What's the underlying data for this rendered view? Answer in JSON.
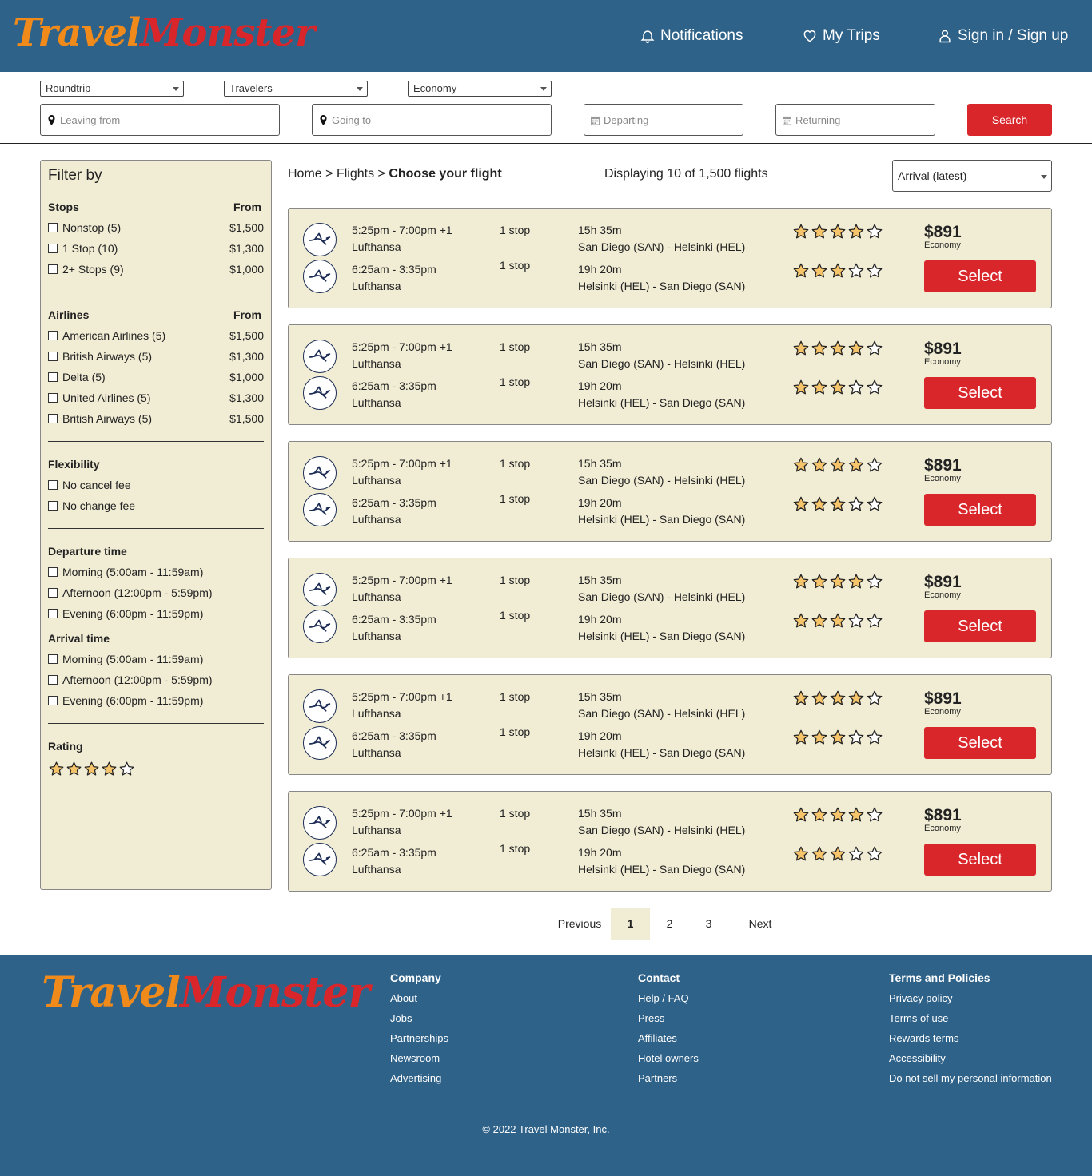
{
  "brand": {
    "name_part1": "Travel",
    "name_part2": "Monster",
    "color_primary": "#f08a1b",
    "color_secondary": "#d9262b"
  },
  "header": {
    "notifications": "Notifications",
    "my_trips": "My Trips",
    "sign_in": "Sign in / Sign up",
    "bg_color": "#2f6289"
  },
  "search": {
    "trip_type": "Roundtrip",
    "travelers": "Travelers",
    "cabin": "Economy",
    "leaving_from_placeholder": "Leaving from",
    "going_to_placeholder": "Going to",
    "departing_placeholder": "Departing",
    "returning_placeholder": "Returning",
    "search_label": "Search"
  },
  "filters": {
    "title": "Filter by",
    "stops": {
      "heading": "Stops",
      "from_label": "From",
      "options": [
        {
          "label": "Nonstop (5)",
          "price": "$1,500"
        },
        {
          "label": "1 Stop (10)",
          "price": "$1,300"
        },
        {
          "label": "2+ Stops (9)",
          "price": "$1,000"
        }
      ]
    },
    "airlines": {
      "heading": "Airlines",
      "from_label": "From",
      "options": [
        {
          "label": "American Airlines (5)",
          "price": "$1,500"
        },
        {
          "label": "British Airways (5)",
          "price": "$1,300"
        },
        {
          "label": "Delta (5)",
          "price": "$1,000"
        },
        {
          "label": "United Airlines (5)",
          "price": "$1,300"
        },
        {
          "label": "British Airways (5)",
          "price": "$1,500"
        }
      ]
    },
    "flexibility": {
      "heading": "Flexibility",
      "options": [
        {
          "label": "No cancel fee"
        },
        {
          "label": "No change fee"
        }
      ]
    },
    "departure_time": {
      "heading": "Departure time",
      "options": [
        {
          "label": "Morning (5:00am - 11:59am)"
        },
        {
          "label": "Afternoon (12:00pm - 5:59pm)"
        },
        {
          "label": "Evening (6:00pm - 11:59pm)"
        }
      ]
    },
    "arrival_time": {
      "heading": "Arrival time",
      "options": [
        {
          "label": "Morning (5:00am - 11:59am)"
        },
        {
          "label": "Afternoon (12:00pm - 5:59pm)"
        },
        {
          "label": "Evening (6:00pm - 11:59pm)"
        }
      ]
    },
    "rating": {
      "heading": "Rating",
      "stars_filled": 4,
      "stars_total": 5
    }
  },
  "results": {
    "breadcrumb_home": "Home",
    "breadcrumb_sep": ">",
    "breadcrumb_flights": "Flights",
    "breadcrumb_current": "Choose your flight",
    "count_text": "Displaying 10 of 1,500 flights",
    "sort_value": "Arrival (latest)",
    "flights": [
      {
        "out": {
          "times": "5:25pm - 7:00pm +1",
          "airline": "Lufthansa",
          "stops": "1 stop",
          "duration": "15h 35m",
          "route": "San Diego (SAN) - Helsinki (HEL)",
          "rating": 4
        },
        "ret": {
          "times": "6:25am - 3:35pm",
          "airline": "Lufthansa",
          "stops": "1 stop",
          "duration": "19h 20m",
          "route": "Helsinki (HEL) - San Diego (SAN)",
          "rating": 3
        },
        "price": "$891",
        "cabin": "Economy",
        "select_label": "Select"
      },
      {
        "out": {
          "times": "5:25pm - 7:00pm +1",
          "airline": "Lufthansa",
          "stops": "1 stop",
          "duration": "15h 35m",
          "route": "San Diego (SAN) - Helsinki (HEL)",
          "rating": 4
        },
        "ret": {
          "times": "6:25am - 3:35pm",
          "airline": "Lufthansa",
          "stops": "1 stop",
          "duration": "19h 20m",
          "route": "Helsinki (HEL) - San Diego (SAN)",
          "rating": 3
        },
        "price": "$891",
        "cabin": "Economy",
        "select_label": "Select"
      },
      {
        "out": {
          "times": "5:25pm - 7:00pm +1",
          "airline": "Lufthansa",
          "stops": "1 stop",
          "duration": "15h 35m",
          "route": "San Diego (SAN) - Helsinki (HEL)",
          "rating": 4
        },
        "ret": {
          "times": "6:25am - 3:35pm",
          "airline": "Lufthansa",
          "stops": "1 stop",
          "duration": "19h 20m",
          "route": "Helsinki (HEL) - San Diego (SAN)",
          "rating": 3
        },
        "price": "$891",
        "cabin": "Economy",
        "select_label": "Select"
      },
      {
        "out": {
          "times": "5:25pm - 7:00pm +1",
          "airline": "Lufthansa",
          "stops": "1 stop",
          "duration": "15h 35m",
          "route": "San Diego (SAN) - Helsinki (HEL)",
          "rating": 4
        },
        "ret": {
          "times": "6:25am - 3:35pm",
          "airline": "Lufthansa",
          "stops": "1 stop",
          "duration": "19h 20m",
          "route": "Helsinki (HEL) - San Diego (SAN)",
          "rating": 3
        },
        "price": "$891",
        "cabin": "Economy",
        "select_label": "Select"
      },
      {
        "out": {
          "times": "5:25pm - 7:00pm +1",
          "airline": "Lufthansa",
          "stops": "1 stop",
          "duration": "15h 35m",
          "route": "San Diego (SAN) - Helsinki (HEL)",
          "rating": 4
        },
        "ret": {
          "times": "6:25am - 3:35pm",
          "airline": "Lufthansa",
          "stops": "1 stop",
          "duration": "19h 20m",
          "route": "Helsinki (HEL) - San Diego (SAN)",
          "rating": 3
        },
        "price": "$891",
        "cabin": "Economy",
        "select_label": "Select"
      },
      {
        "out": {
          "times": "5:25pm - 7:00pm +1",
          "airline": "Lufthansa",
          "stops": "1 stop",
          "duration": "15h 35m",
          "route": "San Diego (SAN) - Helsinki (HEL)",
          "rating": 4
        },
        "ret": {
          "times": "6:25am - 3:35pm",
          "airline": "Lufthansa",
          "stops": "1 stop",
          "duration": "19h 20m",
          "route": "Helsinki (HEL) - San Diego (SAN)",
          "rating": 3
        },
        "price": "$891",
        "cabin": "Economy",
        "select_label": "Select"
      }
    ]
  },
  "pagination": {
    "previous": "Previous",
    "pages": [
      "1",
      "2",
      "3"
    ],
    "current": "1",
    "next": "Next"
  },
  "footer": {
    "company": {
      "heading": "Company",
      "links": [
        "About",
        "Jobs",
        "Partnerships",
        "Newsroom",
        "Advertising"
      ]
    },
    "contact": {
      "heading": "Contact",
      "links": [
        "Help / FAQ",
        "Press",
        "Affiliates",
        "Hotel owners",
        "Partners"
      ]
    },
    "terms": {
      "heading": "Terms and Policies",
      "links": [
        "Privacy policy",
        "Terms of use",
        "Rewards terms",
        "Accessibility",
        "Do not sell my personal information"
      ]
    },
    "copyright": "© 2022 Travel Monster, Inc."
  },
  "icons": {
    "bell": "bell-icon",
    "heart": "heart-icon",
    "user": "user-icon",
    "pin": "map-pin-icon",
    "calendar": "calendar-icon",
    "star": "star-icon",
    "airline_logo": "lufthansa-crane-logo"
  },
  "colors": {
    "card_bg": "#f1ecd4",
    "select_red": "#d9262b",
    "star_fill": "#f6c46a"
  }
}
